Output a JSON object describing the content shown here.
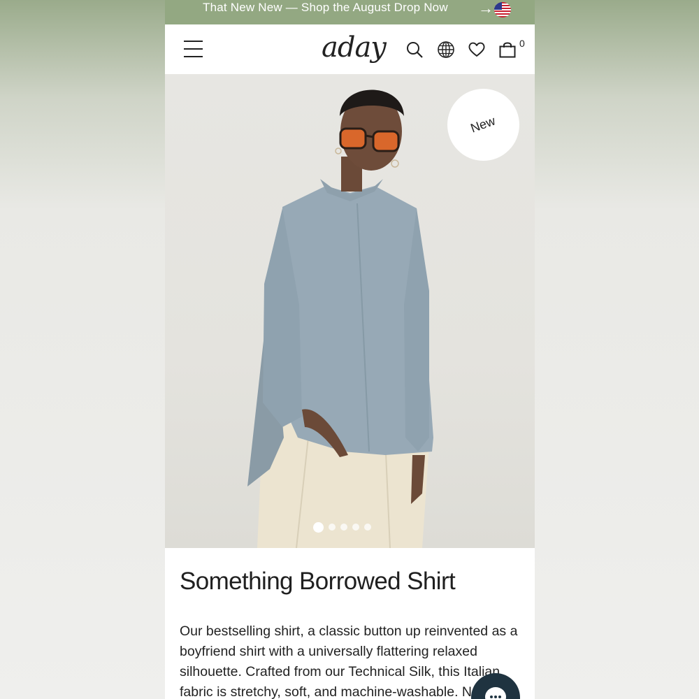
{
  "promo": {
    "text": "That New New — Shop the August Drop Now",
    "arrow": "→",
    "flag_icon": "us-flag-icon"
  },
  "header": {
    "logo": "aday",
    "icons": [
      "menu-icon",
      "search-icon",
      "globe-icon",
      "heart-icon",
      "shopping-bag-icon"
    ],
    "cart_count": "0"
  },
  "product": {
    "badge": "New",
    "title": "Something Borrowed Shirt",
    "description": "Our bestselling shirt, a classic button up reinvented as a boyfriend shirt with a universally flattering relaxed silhouette. Crafted from our Technical Silk, this Italian fabric is stretchy, soft, and machine-washable. N",
    "gallery_count": 5,
    "gallery_active": 1
  },
  "colors": {
    "promo_bg": "#93a882",
    "chat_bg": "#1f3340",
    "shirt": "#97a9b6"
  }
}
